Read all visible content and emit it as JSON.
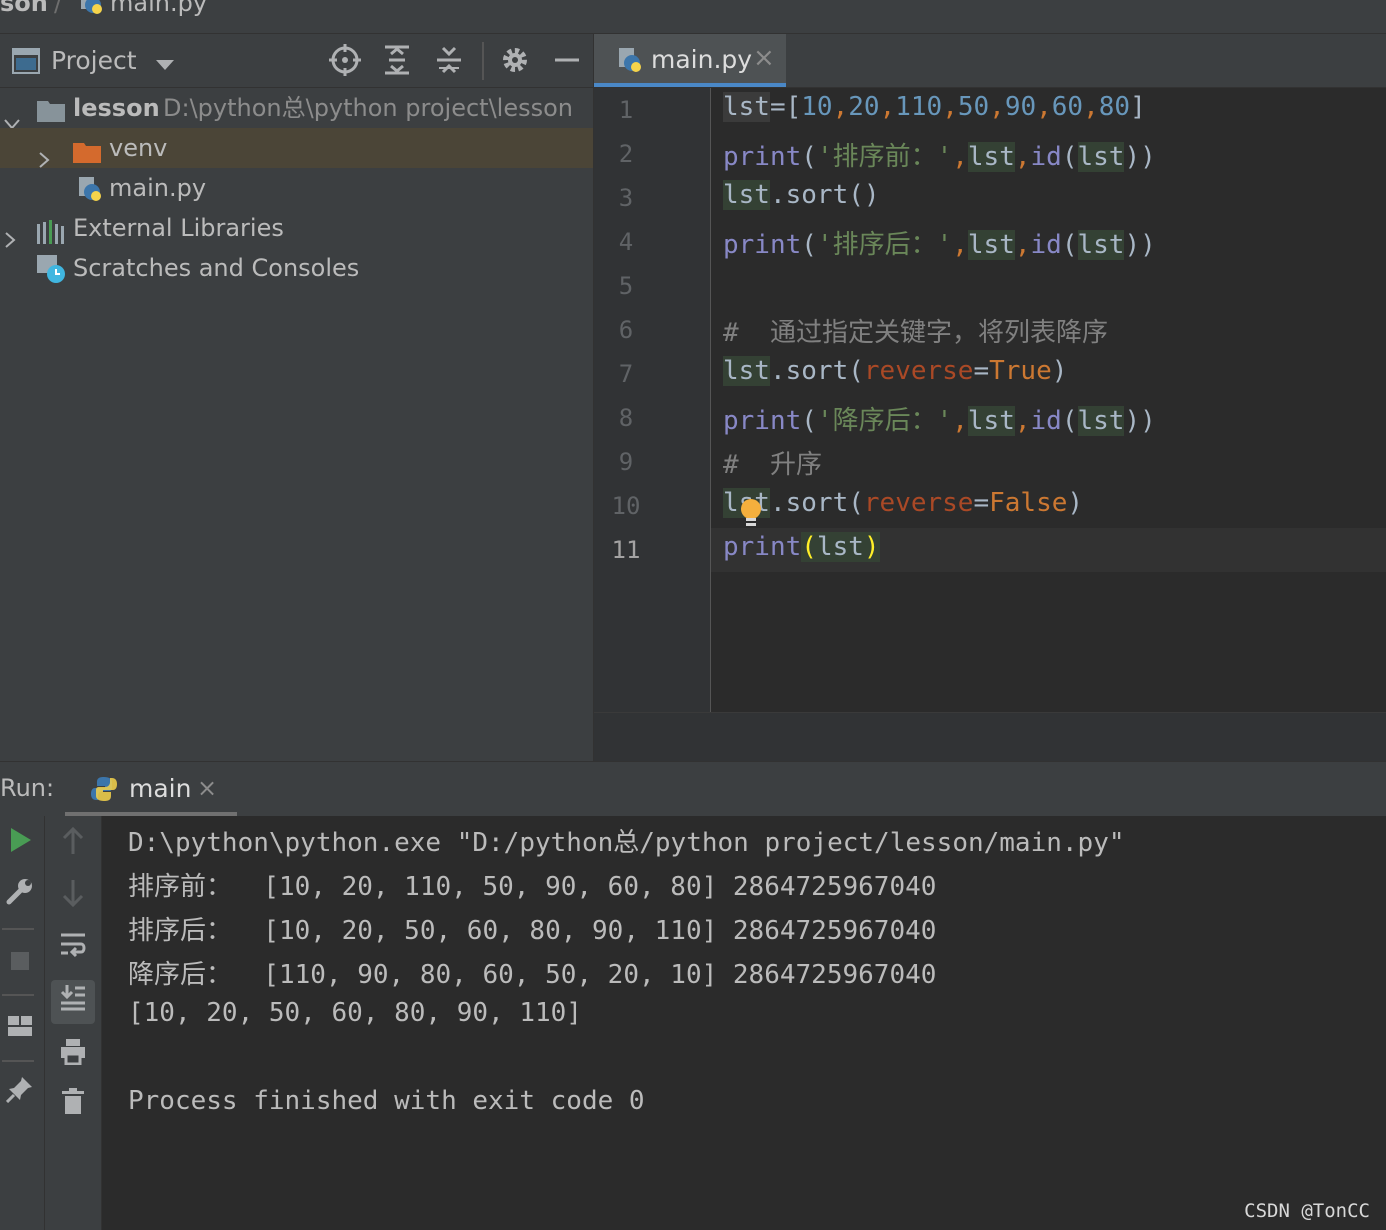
{
  "breadcrumb": {
    "project": "son",
    "separator": "/",
    "file": "main.py"
  },
  "project_panel": {
    "title": "Project",
    "tree": [
      {
        "label": "lesson",
        "path": "D:\\python总\\python project\\lesson"
      },
      {
        "label": "venv"
      },
      {
        "label": "main.py"
      },
      {
        "label": "External Libraries"
      },
      {
        "label": "Scratches and Consoles"
      }
    ]
  },
  "editor": {
    "tab_label": "main.py",
    "tab_close": "×",
    "line_numbers": [
      "1",
      "2",
      "3",
      "4",
      "5",
      "6",
      "7",
      "8",
      "9",
      "10",
      "11"
    ],
    "lines": {
      "l1": [
        "lst",
        "=",
        "[",
        "10",
        ",",
        "20",
        ",",
        "110",
        ",",
        "50",
        ",",
        "90",
        ",",
        "60",
        ",",
        "80",
        "]"
      ],
      "l2": [
        "print",
        "(",
        "'排序前：'",
        ",",
        "lst",
        ",",
        "id",
        "(",
        "lst",
        "))"
      ],
      "l3": [
        "lst",
        ".sort()"
      ],
      "l4": [
        "print",
        "(",
        "'排序后：'",
        ",",
        "lst",
        ",",
        "id",
        "(",
        "lst",
        "))"
      ],
      "l6": "#  通过指定关键字，将列表降序",
      "l7": [
        "lst",
        ".sort(",
        "reverse",
        "=",
        "True",
        ")"
      ],
      "l8": [
        "print",
        "(",
        "'降序后：'",
        ",",
        "lst",
        ",",
        "id",
        "(",
        "lst",
        "))"
      ],
      "l9": "#  升序",
      "l10": [
        "lst",
        ".sort(",
        "reverse",
        "=",
        "False",
        ")"
      ],
      "l11": [
        "print",
        "(",
        "lst",
        ")"
      ]
    }
  },
  "run_panel": {
    "label": "Run:",
    "tab_label": "main",
    "tab_close": "×",
    "output": [
      "D:\\python\\python.exe \"D:/python总/python project/lesson/main.py\"",
      "排序前：  [10, 20, 110, 50, 90, 60, 80] 2864725967040",
      "排序后：  [10, 20, 50, 60, 80, 90, 110] 2864725967040",
      "降序后：  [110, 90, 80, 60, 50, 20, 10] 2864725967040",
      "[10, 20, 50, 60, 80, 90, 110]",
      "",
      "Process finished with exit code 0"
    ]
  },
  "watermark": "CSDN @TonCC",
  "colors": {
    "accent": "#4a88c7",
    "run_green": "#499c54",
    "keyword": "#8888c6",
    "number": "#6897bb",
    "string": "#6a8759"
  }
}
